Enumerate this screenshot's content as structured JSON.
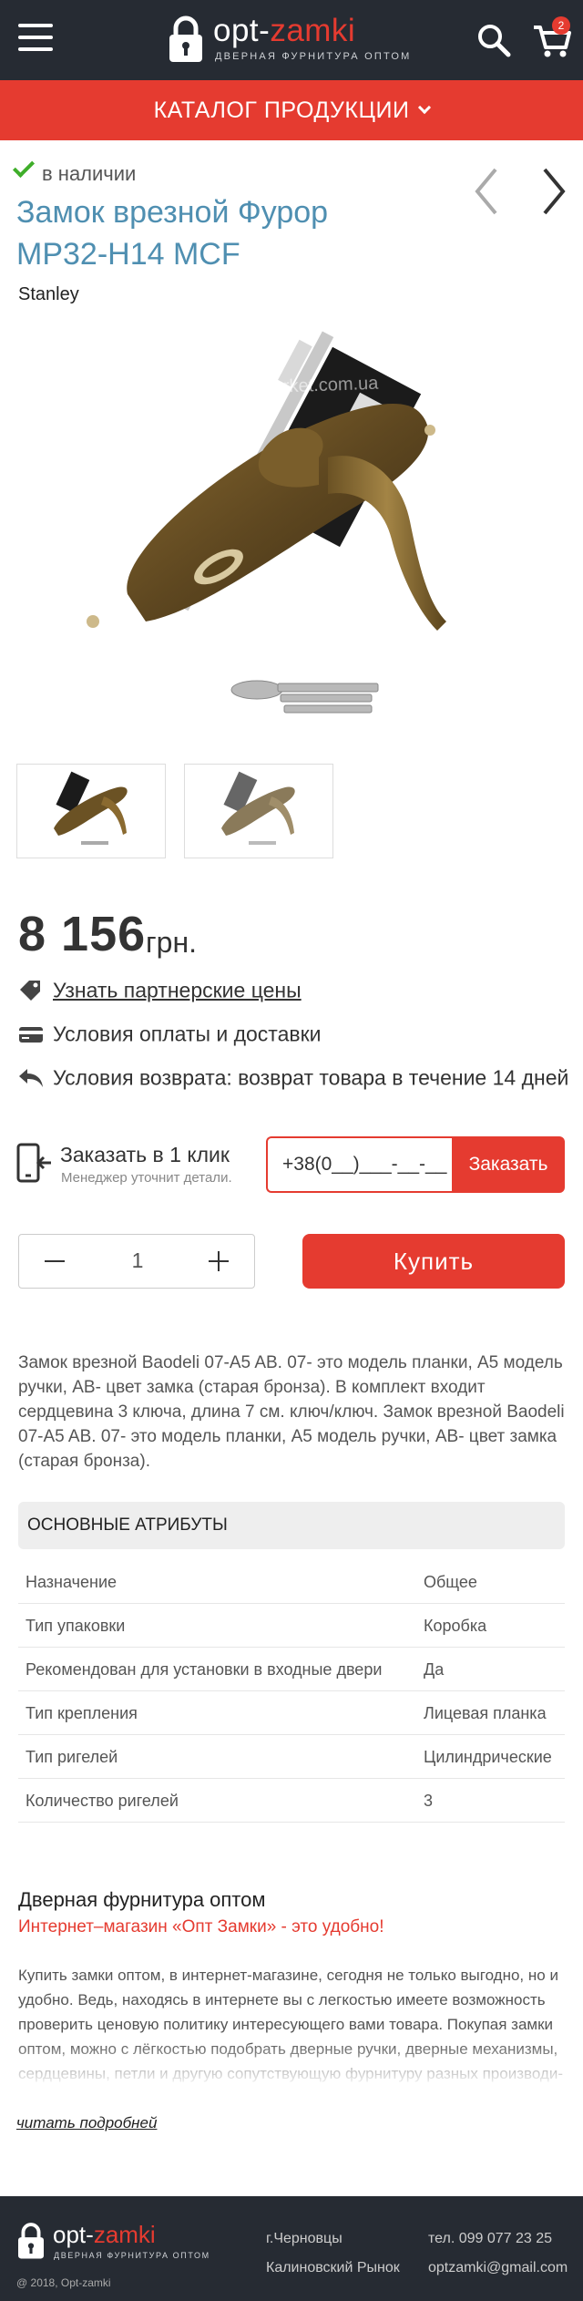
{
  "header": {
    "brand_part1": "opt-",
    "brand_part2": "zamki",
    "tagline": "ДВЕРНАЯ ФУРНИТУРА ОПТОМ",
    "cart_count": "2"
  },
  "catalog": {
    "label": "КАТАЛОГ ПРОДУКЦИИ"
  },
  "product": {
    "stock": "в наличии",
    "title": "Замок врезной Фурор MP32-H14 MCF",
    "brand": "Stanley",
    "image_watermark": "zamki-market.com.ua",
    "price": "8 156",
    "currency": "грн.",
    "info": [
      {
        "icon": "tag-icon",
        "label": "Узнать партнерские цены"
      },
      {
        "icon": "credit-card-icon",
        "label": "Условия оплаты и доставки"
      },
      {
        "icon": "return-icon",
        "label": "Условия возврата: возврат товара в течение 14 дней"
      }
    ]
  },
  "one_click": {
    "title": "Заказать в 1 клик",
    "subtitle": "Менеджер уточнит детали.",
    "phone_placeholder": "+38(0__)___-__-__",
    "button": "Заказать"
  },
  "cart": {
    "quantity": "1",
    "buy_button": "Купить"
  },
  "description": "Замок врезной Baodeli 07-A5 AB. 07- это модель планки, A5 модель ручки, AB- цвет замка (старая бронза). В комплект входит сердцевина 3 ключа, длина 7 см. ключ/ключ.  Замок врезной Baodeli 07-A5 AB. 07- это модель планки, A5 модель ручки, AB- цвет замка (старая бронза).",
  "attributes": {
    "heading": "ОСНОВНЫЕ АТРИБУТЫ",
    "rows": [
      {
        "key": "Назначение",
        "value": "Общее"
      },
      {
        "key": "Тип упаковки",
        "value": "Коробка"
      },
      {
        "key": "Рекомендован для установки в входные двери",
        "value": "Да"
      },
      {
        "key": "Тип крепления",
        "value": "Лицевая планка"
      },
      {
        "key": "Тип ригелей",
        "value": "Цилиндрические"
      },
      {
        "key": "Количество ригелей",
        "value": "3"
      }
    ]
  },
  "seo": {
    "title": "Дверная фурнитура оптом",
    "subtitle": "Интернет–магазин «Опт Замки» - это удобно!",
    "text": "Купить замки оптом, в интернет-магазине, сегодня не только выгодно, но и удобно. Ведь, находясь в интернете вы с легкостью имеете возможность проверить ценовую политику интересующего вами товара. Покупая замки оптом, можно с лёгкостью подобрать дверные ручки, дверные механизмы, сердцевины, петли и другую сопутствующую фурнитуру разных производи-",
    "read_more": "читать подробней"
  },
  "footer": {
    "brand_part1": "opt-",
    "brand_part2": "zamki",
    "tagline": "ДВЕРНАЯ ФУРНИТУРА ОПТОМ",
    "copyright": "@ 2018, Opt-zamki",
    "city": "г.Черновцы",
    "address": "Калиновский Рынок",
    "phone": "тел. 099 077 23 25",
    "email": "optzamki@gmail.com"
  },
  "colors": {
    "accent": "#e53b30",
    "dark": "#262b33",
    "title": "#4f8fb1",
    "stock": "#3fae2a"
  }
}
